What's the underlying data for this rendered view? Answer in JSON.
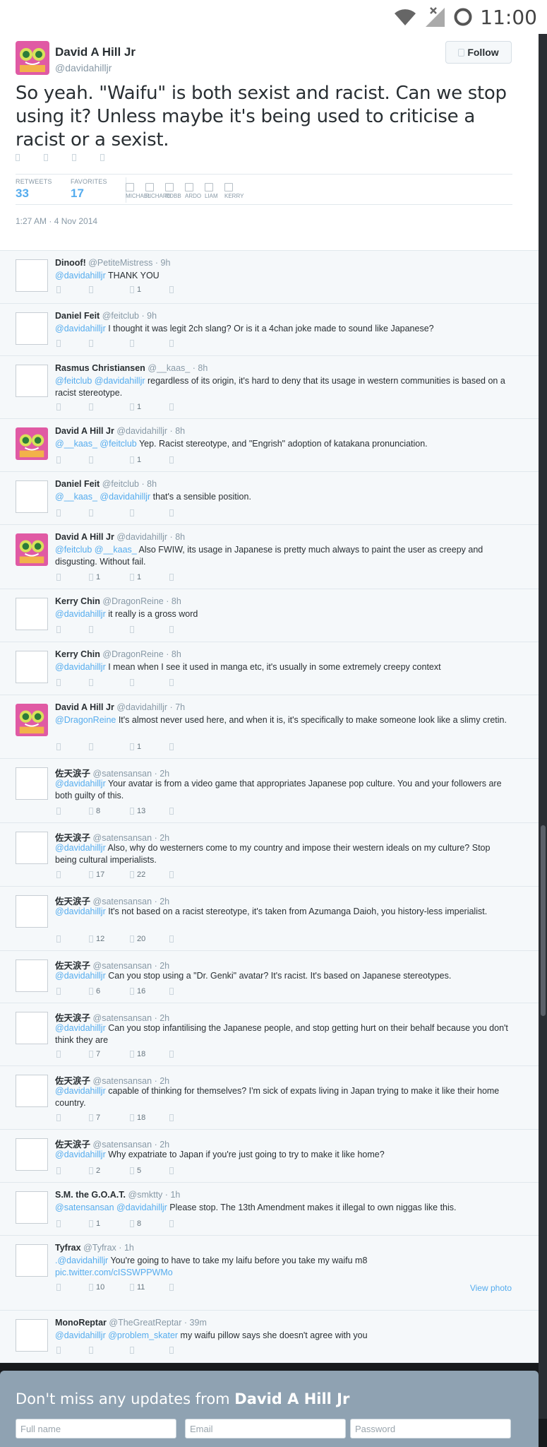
{
  "status_bar": {
    "time": "11:00"
  },
  "tweet": {
    "author_name": "David A Hill Jr",
    "author_handle": "@davidahilljr",
    "follow_label": "Follow",
    "text": "So yeah. \"Waifu\" is both sexist and racist. Can we stop using it? Unless maybe it's being used to criticise a racist or a sexist.",
    "retweets_label": "RETWEETS",
    "retweets": "33",
    "favorites_label": "FAVORITES",
    "favorites": "17",
    "favoriters": [
      "MICHAEL",
      "RICHARD",
      "ROBB",
      "ARDO",
      "LIAM",
      "KERRY"
    ],
    "timestamp": "1:27 AM · 4 Nov 2014"
  },
  "replies": [
    {
      "name": "Dinoof!",
      "handle": "@PetiteMistress",
      "time": "9h",
      "mentions": "@davidahilljr",
      "text": " THANK YOU",
      "retweets": "",
      "favorites": "1",
      "avatar": "blank"
    },
    {
      "name": "Daniel Feit",
      "handle": "@feitclub",
      "time": "9h",
      "mentions": "@davidahilljr",
      "text": " I thought it was legit 2ch slang? Or is it a 4chan joke made to sound like Japanese?",
      "retweets": "",
      "favorites": "",
      "avatar": "blank"
    },
    {
      "name": "Rasmus Christiansen",
      "handle": "@__kaas_",
      "time": "8h",
      "mentions": "@feitclub @davidahilljr",
      "text": " regardless of its origin, it's hard to deny that its usage in western communities is based on a racist stereotype.",
      "retweets": "",
      "favorites": "1",
      "avatar": "blank"
    },
    {
      "name": "David A Hill Jr",
      "handle": "@davidahilljr",
      "time": "8h",
      "mentions": "@__kaas_ @feitclub",
      "text": " Yep. Racist stereotype, and \"Engrish\" adoption of katakana pronunciation.",
      "retweets": "",
      "favorites": "1",
      "avatar": "genki"
    },
    {
      "name": "Daniel Feit",
      "handle": "@feitclub",
      "time": "8h",
      "mentions": "@__kaas_ @davidahilljr",
      "text": " that's a sensible position.",
      "retweets": "",
      "favorites": "",
      "avatar": "blank"
    },
    {
      "name": "David A Hill Jr",
      "handle": "@davidahilljr",
      "time": "8h",
      "mentions": "@feitclub @__kaas_",
      "text": " Also FWIW, its usage in Japanese is pretty much always to paint the user as creepy and disgusting. Without fail.",
      "retweets": "1",
      "favorites": "1",
      "avatar": "genki"
    },
    {
      "name": "Kerry Chin",
      "handle": "@DragonReine",
      "time": "8h",
      "mentions": "@davidahilljr",
      "text": " it really is a gross word",
      "retweets": "",
      "favorites": "",
      "avatar": "blank"
    },
    {
      "name": "Kerry Chin",
      "handle": "@DragonReine",
      "time": "8h",
      "mentions": "@davidahilljr",
      "text": " I mean when I see it used in manga etc, it's usually in some extremely creepy context",
      "retweets": "",
      "favorites": "",
      "avatar": "blank"
    },
    {
      "name": "David A Hill Jr",
      "handle": "@davidahilljr",
      "time": "7h",
      "mentions": "@DragonReine",
      "text": " It's almost never used here, and when it is, it's specifically to make someone look like a slimy cretin.",
      "retweets": "",
      "favorites": "1",
      "avatar": "genki"
    },
    {
      "name": "佐天涙子",
      "handle": "@satensansan",
      "time": "2h",
      "mentions": "@davidahilljr",
      "text": " Your avatar is from a video game that appropriates Japanese pop culture. You and your followers are both guilty of this.",
      "retweets": "8",
      "favorites": "13",
      "avatar": "blank"
    },
    {
      "name": "佐天涙子",
      "handle": "@satensansan",
      "time": "2h",
      "mentions": "@davidahilljr",
      "text": " Also, why do westerners come to my country and impose their western ideals on my culture? Stop being cultural imperialists.",
      "retweets": "17",
      "favorites": "22",
      "avatar": "blank"
    },
    {
      "name": "佐天涙子",
      "handle": "@satensansan",
      "time": "2h",
      "mentions": "@davidahilljr",
      "text": " It's not based on a racist stereotype, it's taken from Azumanga Daioh, you history-less imperialist.",
      "retweets": "12",
      "favorites": "20",
      "avatar": "blank"
    },
    {
      "name": "佐天涙子",
      "handle": "@satensansan",
      "time": "2h",
      "mentions": "@davidahilljr",
      "text": " Can you stop using a \"Dr. Genki\" avatar? It's racist. It's based on Japanese stereotypes.",
      "retweets": "6",
      "favorites": "16",
      "avatar": "blank"
    },
    {
      "name": "佐天涙子",
      "handle": "@satensansan",
      "time": "2h",
      "mentions": "@davidahilljr",
      "text": " Can you stop infantilising the Japanese people, and stop getting hurt on their behalf because you don't think they are",
      "retweets": "7",
      "favorites": "18",
      "avatar": "blank"
    },
    {
      "name": "佐天涙子",
      "handle": "@satensansan",
      "time": "2h",
      "mentions": "@davidahilljr",
      "text": " capable of thinking for themselves? I'm sick of expats living in Japan trying to make it like their home country.",
      "retweets": "7",
      "favorites": "18",
      "avatar": "blank"
    },
    {
      "name": "佐天涙子",
      "handle": "@satensansan",
      "time": "2h",
      "mentions": "@davidahilljr",
      "text": " Why expatriate to Japan if you're just going to try to make it like home?",
      "retweets": "2",
      "favorites": "5",
      "avatar": "blank"
    },
    {
      "name": "S.M. the G.O.A.T.",
      "handle": "@smktty",
      "time": "1h",
      "mentions": "@satensansan @davidahilljr",
      "text": " Please stop. The 13th Amendment makes it illegal to own niggas like this.",
      "retweets": "1",
      "favorites": "8",
      "avatar": "blank"
    },
    {
      "name": "Tyfrax",
      "handle": "@Tyfrax",
      "time": "1h",
      "mentions": ".@davidahilljr",
      "text": " You're going to have to take my laifu before you take my waifu m8",
      "link": "pic.twitter.com/cISSWPPWMo",
      "view_photo": "View photo",
      "retweets": "10",
      "favorites": "11",
      "avatar": "blank"
    },
    {
      "name": "MonoReptar",
      "handle": "@TheGreatReptar",
      "time": "39m",
      "mentions": "@davidahilljr @problem_skater",
      "text": " my waifu pillow says she doesn't agree with you",
      "retweets": "",
      "favorites": "",
      "avatar": "blank"
    }
  ],
  "signup": {
    "title_prefix": "Don't miss any updates from ",
    "title_name": "David A Hill Jr",
    "full_name_placeholder": "Full name",
    "email_placeholder": "Email",
    "password_placeholder": "Password"
  },
  "colors": {
    "link": "#55acee",
    "background": "#f5f8fa",
    "signup_bg": "#8fa2b2"
  },
  "icons": [
    "wifi-icon",
    "signal-icon",
    "sync-icon",
    "follow-user-icon",
    "reply-icon",
    "retweet-icon",
    "favorite-icon",
    "more-icon"
  ]
}
